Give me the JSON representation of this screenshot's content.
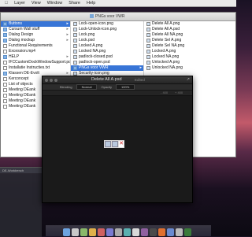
{
  "menubar": {
    "items": [
      "Layer",
      "View",
      "Window",
      "Share",
      "Help"
    ]
  },
  "finder": {
    "title": "PNGs voor VWR",
    "column1": [
      {
        "label": "Buttons",
        "icon": "folder-icon",
        "selected": true
      },
      {
        "label": "Cursum Wall stuff",
        "icon": "folder-icon"
      },
      {
        "label": "Dialog Design",
        "icon": "folder-icon"
      },
      {
        "label": "Dialog mockup",
        "icon": "folder-icon"
      },
      {
        "label": "Functional Requirements",
        "icon": "document-icon"
      },
      {
        "label": "Excession.mp4",
        "icon": "document-icon"
      },
      {
        "label": "HELP",
        "icon": "folder-icon"
      },
      {
        "label": "IFCCustomDockWindowSupport.pdf",
        "icon": "document-icon"
      },
      {
        "label": "Installatie Instructies.txt",
        "icon": "document-icon"
      },
      {
        "label": "Klassen DE-Evolt",
        "icon": "folder-icon"
      },
      {
        "label": "Kerconcept",
        "icon": "document-icon"
      },
      {
        "label": "List of objects",
        "icon": "document-icon"
      },
      {
        "label": "Meeting DEank",
        "icon": "document-icon"
      },
      {
        "label": "Meeting DEank",
        "icon": "document-icon"
      },
      {
        "label": "Meeting DEank",
        "icon": "document-icon"
      },
      {
        "label": "Meeting DEank",
        "icon": "document-icon"
      }
    ],
    "column2": [
      {
        "label": "Lock-open-icon.png",
        "icon": "image-icon"
      },
      {
        "label": "Lock-Unlock-icon.png",
        "icon": "image-icon"
      },
      {
        "label": "Lock.png",
        "icon": "image-icon"
      },
      {
        "label": "Lock.psd",
        "icon": "image-icon"
      },
      {
        "label": "Locked A.png",
        "icon": "image-icon"
      },
      {
        "label": "Locked NA.png",
        "icon": "image-icon"
      },
      {
        "label": "padlock-closed.psd",
        "icon": "image-icon"
      },
      {
        "label": "padlock-open.psd",
        "icon": "image-icon"
      },
      {
        "label": "PNGs voor VWR",
        "icon": "folder-icon",
        "selected": true
      },
      {
        "label": "Security-icon.png",
        "icon": "image-icon"
      }
    ],
    "column3": [
      {
        "label": "Delete All A.png",
        "icon": "image-icon"
      },
      {
        "label": "Delete All A.psd",
        "icon": "image-icon"
      },
      {
        "label": "Delete All NA.png",
        "icon": "image-icon"
      },
      {
        "label": "Delete Sel A.png",
        "icon": "image-icon"
      },
      {
        "label": "Delete Sel NA.png",
        "icon": "image-icon"
      },
      {
        "label": "Locked A.png",
        "icon": "image-icon"
      },
      {
        "label": "Locked NA.png",
        "icon": "image-icon"
      },
      {
        "label": "Unlocked A.png",
        "icon": "image-icon"
      },
      {
        "label": "Unlocked NA.png",
        "icon": "image-icon"
      }
    ]
  },
  "editor": {
    "document_title": "Delete All A.psd",
    "status": "Edited",
    "toolbar": {
      "blending_label": "Blending",
      "blending_value": "Normal",
      "opacity_label": "Opacity",
      "opacity_value": "100%"
    },
    "zoom_labels": [
      "- 400",
      "+ 400"
    ]
  },
  "terminal": {
    "title": "DE-Workbench"
  },
  "colors": {
    "selection": "#3875d7",
    "editor_bg": "#1c1c1c"
  }
}
